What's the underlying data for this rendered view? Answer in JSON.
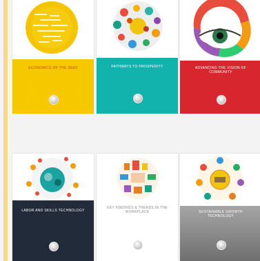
{
  "covers": [
    {
      "title": "ECONOMICS OF THE SEAS",
      "subtitle": "",
      "band_color": "#f6c800",
      "title_color": "#c44a1f",
      "art_color": "#f5c400"
    },
    {
      "title": "PATHWAYS TO PROSPERITY",
      "subtitle": "",
      "band_color": "#12b3ad",
      "title_color": "#ffffff",
      "art_color": "#e8e8e8"
    },
    {
      "title": "ADVANCING THE VISION OF COMMUNITY",
      "subtitle": "",
      "band_color": "#d8262e",
      "title_color": "#ffffff",
      "art_color": "#ffffff"
    },
    {
      "title": "LABOR AND SKILLS TECHNOLOGY",
      "subtitle": "",
      "band_color": "#222b39",
      "title_color": "#ffffff",
      "art_color": "#ffffff"
    },
    {
      "title": "KEY FINDINGS & TRENDS IN THE WORKPLACE",
      "subtitle": "",
      "band_color": "#ffffff",
      "title_color": "#8a8a8a",
      "art_color": "#ffffff"
    },
    {
      "title": "SUSTAINABLE GROWTH TECHNOLOGY",
      "subtitle": "",
      "band_color": "#8e8e8e",
      "title_color": "#ffffff",
      "art_color": "#ffffff"
    }
  ]
}
